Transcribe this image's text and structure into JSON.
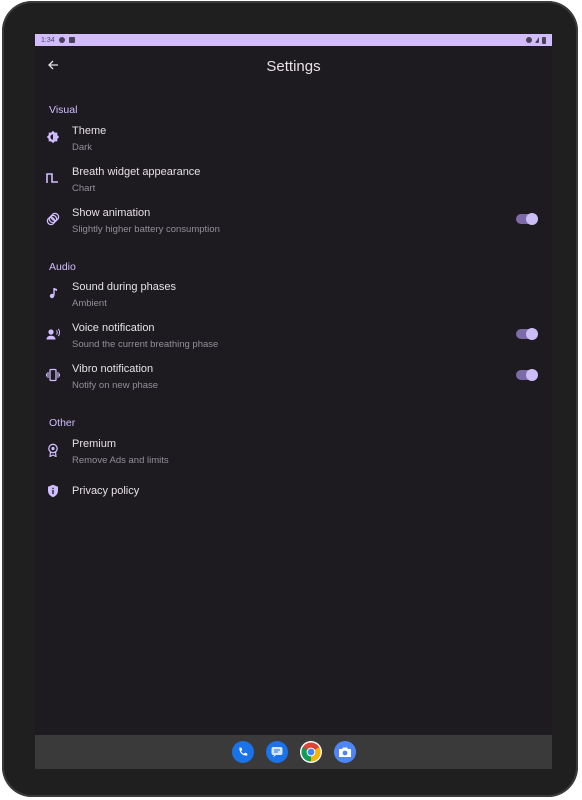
{
  "status_bar": {
    "time": "1:34"
  },
  "header": {
    "title": "Settings"
  },
  "sections": {
    "visual": "Visual",
    "audio": "Audio",
    "other": "Other"
  },
  "settings": {
    "theme": {
      "label": "Theme",
      "value": "Dark",
      "icon": "theme-icon"
    },
    "breath_widget": {
      "label": "Breath widget appearance",
      "value": "Chart",
      "icon": "chart-wave-icon"
    },
    "show_animation": {
      "label": "Show animation",
      "value": "Slightly higher battery consumption",
      "enabled": true,
      "icon": "animation-icon"
    },
    "sound_phases": {
      "label": "Sound during phases",
      "value": "Ambient",
      "icon": "music-note-icon"
    },
    "voice_notification": {
      "label": "Voice notification",
      "value": "Sound the current breathing phase",
      "enabled": true,
      "icon": "voice-icon"
    },
    "vibro_notification": {
      "label": "Vibro notification",
      "value": "Notify on new phase",
      "enabled": true,
      "icon": "vibration-icon"
    },
    "premium": {
      "label": "Premium",
      "value": "Remove Ads and limits",
      "icon": "award-icon"
    },
    "privacy": {
      "label": "Privacy policy",
      "icon": "shield-icon"
    }
  },
  "dock": {
    "apps": [
      "phone-icon",
      "messages-icon",
      "chrome-icon",
      "camera-icon"
    ]
  },
  "colors": {
    "background": "#1d1b20",
    "accent": "#d0bcff",
    "status_bar": "#d3bcfd",
    "toggle_track": "#7d6aa8"
  }
}
